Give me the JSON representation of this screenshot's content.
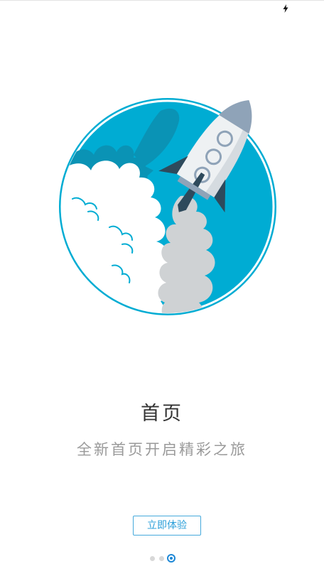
{
  "status_bar": {
    "icon": "charging-icon"
  },
  "hero": {
    "icon": "rocket-launch-illustration",
    "colors": {
      "circle": "#00acd3",
      "rocket_body": "#eef1f3",
      "rocket_dark": "#2e4a5c",
      "smoke": "#cfd2d4"
    }
  },
  "guide": {
    "title": "首页",
    "subtitle": "全新首页开启精彩之旅",
    "cta_label": "立即体验"
  },
  "pager": {
    "total": 3,
    "current": 3
  },
  "colors": {
    "accent": "#1e88d6",
    "title": "#333333",
    "subtitle": "#9a9a9a"
  }
}
